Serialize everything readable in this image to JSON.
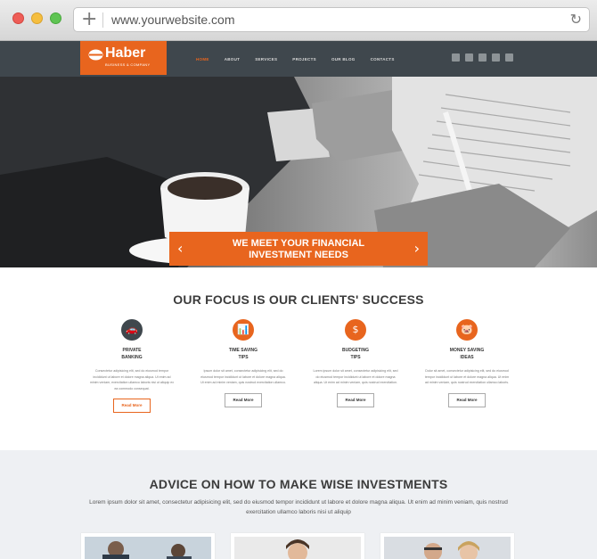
{
  "browser": {
    "url": "www.yourwebsite.com",
    "new_tab_glyph": "+",
    "reload_glyph": "↻",
    "icons": [
      "close-dot-icon",
      "minimize-dot-icon",
      "maximize-dot-icon",
      "plus-icon",
      "reload-icon"
    ]
  },
  "site": {
    "logo": {
      "name": "Haber",
      "tagline": "BUSINESS & COMPANY"
    },
    "nav": [
      "HOME",
      "ABOUT",
      "SERVICES",
      "PROJECTS",
      "OUR BLOG",
      "CONTACTS"
    ],
    "active_nav": "HOME",
    "social_icons": [
      "twitter-icon",
      "youtube-icon",
      "rss-icon",
      "facebook-icon",
      "vimeo-icon"
    ]
  },
  "hero": {
    "banner_text": "WE MEET YOUR FINANCIAL\nINVESTMENT NEEDS",
    "prev_glyph": "‹",
    "next_glyph": "›"
  },
  "focus": {
    "title": "OUR FOCUS IS OUR CLIENTS' SUCCESS",
    "features": [
      {
        "title": "PRIVATE\nBANKING",
        "icon": "car-icon",
        "glyph": "🚗",
        "desc": "Consectetur adipisicing elit, sed do eiusmod tempor incididunt ut labore et dolore magna aliqua. Ut enim ad minim veniam, exercitation ullamco laboris nisi ut aliquip ex ea commodo consequat.",
        "button": "Read More"
      },
      {
        "title": "TIME SAVING\nTIPS",
        "icon": "chart-icon",
        "glyph": "📊",
        "desc": "Ipsum dolor sit amet, consectetur adipisicing elit, sed do eiusmod tempor incididunt ut labore et dolore magna aliqua. Ut enim ad minim veniam, quis nostrud exercitation ullamco.",
        "button": "Read More"
      },
      {
        "title": "BUDGETING\nTIPS",
        "icon": "money-bag-icon",
        "glyph": "$",
        "desc": "Lorem ipsum dolor sit amet, consectetur adipisicing elit, sed do eiusmod tempor incididunt ut labore et dolore magna aliqua. Ut enim ad minim veniam, quis nostrud exercitation.",
        "button": "Read More"
      },
      {
        "title": "MONEY SAVING\nIDEAS",
        "icon": "piggy-bank-icon",
        "glyph": "🐷",
        "desc": "Dolor sit amet, consectetur adipisicing elit, sed do eiusmod tempor incididunt ut labore et dolore magna aliqua. Ut enim ad minim veniam, quis nostrud exercitation ullamco laboris.",
        "button": "Read More"
      }
    ]
  },
  "advice": {
    "title": "ADVICE ON HOW TO MAKE WISE INVESTMENTS",
    "text": "Lorem ipsum dolor sit amet, consectetur adipisicing elit, sed do eiusmod tempor incididunt ut labore et dolore magna aliqua. Ut enim ad minim veniam, quis nostrud exercitation ullamco laboris nisi ut aliquip"
  },
  "colors": {
    "accent": "#e8651e",
    "header": "#3f474d",
    "advice_bg": "#eef0f3"
  }
}
